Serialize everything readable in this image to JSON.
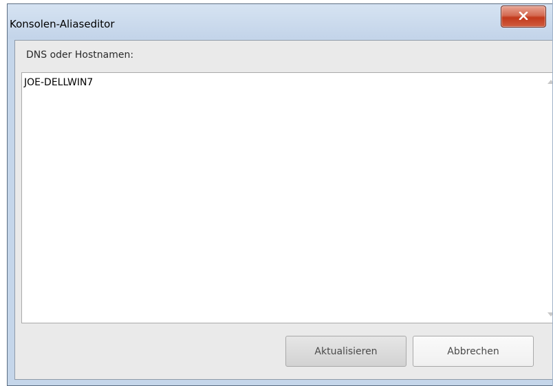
{
  "window": {
    "title": "Konsolen-Aliaseditor",
    "close_glyph": "X",
    "icons": {
      "close": "close-icon"
    },
    "colors": {
      "frame": "#c5d6ea",
      "close_button": "#c2391c",
      "client_area": "#eaeaea"
    }
  },
  "form": {
    "label": "DNS oder Hostnamen:",
    "hosts_value": "JOE-DELLWIN7",
    "scroll_icons": [
      "scroll-up-arrow-icon",
      "scroll-down-arrow-icon"
    ]
  },
  "buttons": {
    "update_label": "Aktualisieren",
    "cancel_label": "Abbrechen"
  }
}
